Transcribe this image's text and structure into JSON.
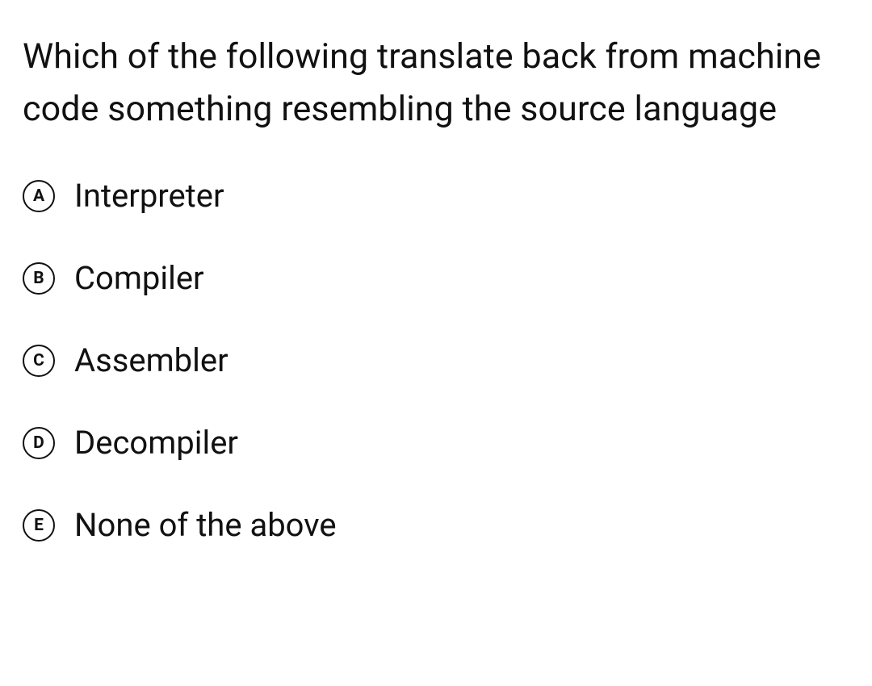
{
  "question": "Which of the following translate back from machine code something resembling the source language",
  "options": [
    {
      "letter": "A",
      "text": "Interpreter"
    },
    {
      "letter": "B",
      "text": "Compiler"
    },
    {
      "letter": "C",
      "text": "Assembler"
    },
    {
      "letter": "D",
      "text": "Decompiler"
    },
    {
      "letter": "E",
      "text": "None of the above"
    }
  ]
}
